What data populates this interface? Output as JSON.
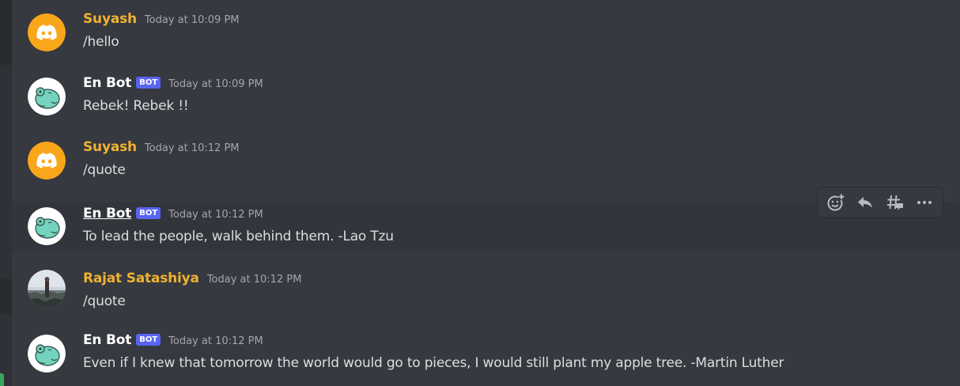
{
  "colors": {
    "background": "#36393f",
    "hover_row": "#32353b",
    "username_user": "#f0b232",
    "username_bot": "#ffffff",
    "bot_tag": "#5865f2",
    "timestamp": "#a3a6aa",
    "text": "#dcddde",
    "discord_avatar_bg": "#faa61a",
    "frog_green": "#74d3bd"
  },
  "bot_tag": "BOT",
  "messages": [
    {
      "username": "Suyash",
      "timestamp": "Today at 10:09 PM",
      "text": "/hello",
      "avatar": "discord-logo",
      "is_bot": false
    },
    {
      "username": "En Bot",
      "timestamp": "Today at 10:09 PM",
      "text": "Rebek! Rebek !!",
      "avatar": "frog",
      "is_bot": true
    },
    {
      "username": "Suyash",
      "timestamp": "Today at 10:12 PM",
      "text": "/quote",
      "avatar": "discord-logo",
      "is_bot": false
    },
    {
      "username": "En Bot",
      "timestamp": "Today at 10:12 PM",
      "text": "To lead the people, walk behind them. -Lao Tzu",
      "avatar": "frog",
      "is_bot": true
    },
    {
      "username": "Rajat Satashiya",
      "timestamp": "Today at 10:12 PM",
      "text": "/quote",
      "avatar": "photo",
      "is_bot": false
    },
    {
      "username": "En Bot",
      "timestamp": "Today at 10:12 PM",
      "text": "Even if I knew that tomorrow the world would go to pieces, I would still plant my apple tree.  -Martin Luther",
      "avatar": "frog",
      "is_bot": true
    }
  ],
  "toolbar": {
    "icons": [
      "add-reaction-icon",
      "reply-icon",
      "create-thread-icon",
      "more-icon"
    ]
  }
}
